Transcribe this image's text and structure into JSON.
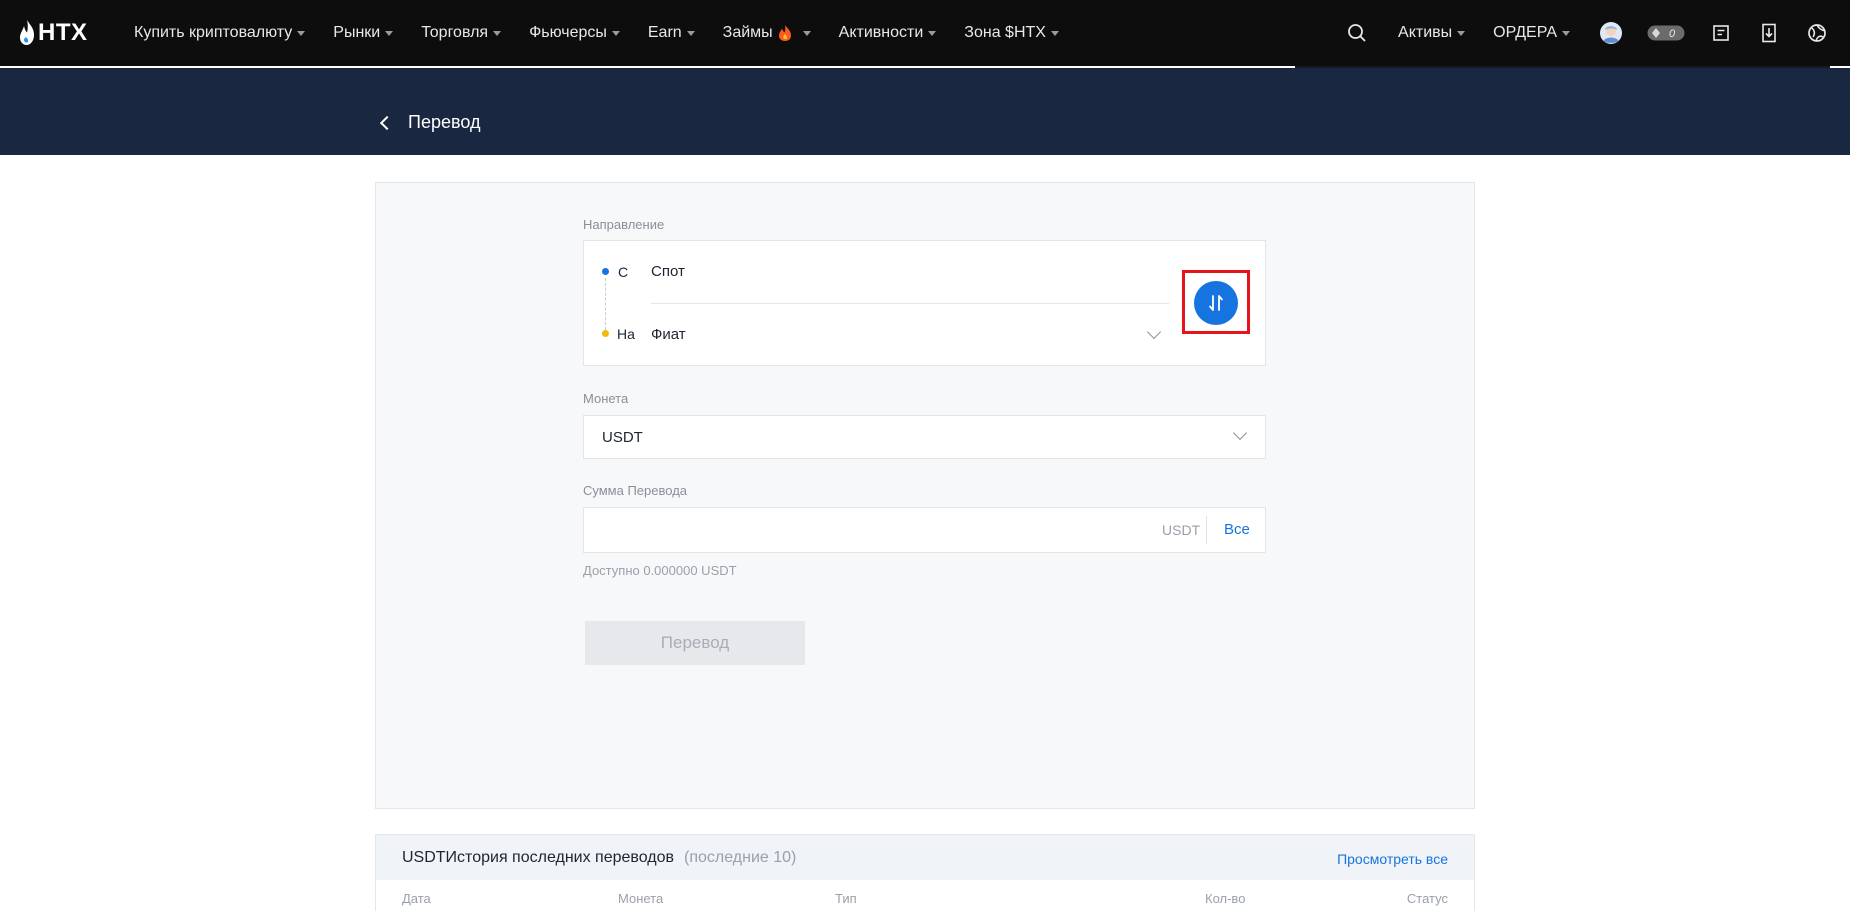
{
  "nav": {
    "logo": "HTX",
    "items": [
      {
        "label": "Купить криптовалюту"
      },
      {
        "label": "Рынки"
      },
      {
        "label": "Торговля"
      },
      {
        "label": "Фьючерсы"
      },
      {
        "label": "Earn"
      },
      {
        "label": "Займы"
      },
      {
        "label": "Активности"
      },
      {
        "label": "Зона $HTX"
      }
    ],
    "right": {
      "assets": "Активы",
      "orders": "ОРДЕРА",
      "notification_count": "0"
    }
  },
  "page": {
    "title": "Перевод"
  },
  "form": {
    "direction_label": "Направление",
    "from_label": "С",
    "from_value": "Спот",
    "to_label": "На",
    "to_value": "Фиат",
    "coin_label": "Монета",
    "coin_value": "USDT",
    "amount_label": "Сумма Перевода",
    "amount_value": "",
    "amount_unit": "USDT",
    "all_label": "Все",
    "available": "Доступно 0.000000 USDT",
    "submit_label": "Перевод"
  },
  "history": {
    "title": "USDTИстория последних переводов",
    "subtitle": "(последние 10)",
    "view_all": "Просмотреть все",
    "columns": [
      "Дата",
      "Монета",
      "Тип",
      "Кол-во",
      "Статус"
    ]
  },
  "colors": {
    "nav_bg": "#0d0d0d",
    "banner_bg": "#1a2741",
    "accent": "#1674e0",
    "from_dot": "#1674e0",
    "to_dot": "#f0b90b",
    "highlight": "#e8141c"
  }
}
